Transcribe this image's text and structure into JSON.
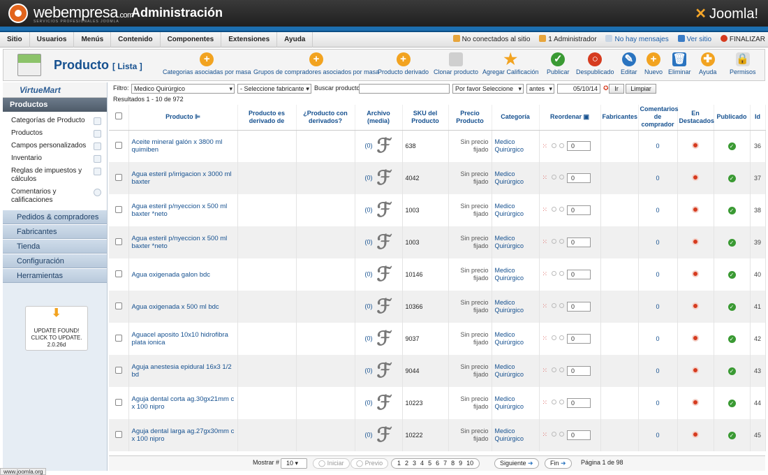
{
  "header": {
    "brand": "webempresa",
    "brand_suffix": ".com",
    "brand_sub": "SERVICIOS PROFESIONALES JOOMLA",
    "title": "Administración",
    "joomla_logo": "Joomla!"
  },
  "menu": [
    "Sitio",
    "Usuarios",
    "Menús",
    "Contenido",
    "Componentes",
    "Extensiones",
    "Ayuda"
  ],
  "status": {
    "visitors": "No conectados al sitio",
    "admins": "1 Administrador",
    "messages": "No hay mensajes",
    "view_site": "Ver sitio",
    "logout": "FINALIZAR"
  },
  "toolbar": {
    "page_title": "Producto",
    "page_sub": "[ Lista ]",
    "buttons": [
      {
        "label": "Categorias asociadas por masa",
        "icon": "plus-icon"
      },
      {
        "label": "Grupos de compradores asociados por masa",
        "icon": "plus-icon"
      },
      {
        "label": "Producto derivado",
        "icon": "plus-icon"
      },
      {
        "label": "Clonar producto",
        "icon": "clone-icon"
      },
      {
        "label": "Agregar Calificación",
        "icon": "star-icon"
      },
      {
        "label": "Publicar",
        "icon": "check-icon"
      },
      {
        "label": "Despublicado",
        "icon": "unpublish-icon"
      },
      {
        "label": "Editar",
        "icon": "edit-icon"
      },
      {
        "label": "Nuevo",
        "icon": "plus-icon"
      },
      {
        "label": "Eliminar",
        "icon": "trash-icon"
      },
      {
        "label": "Ayuda",
        "icon": "help-icon"
      },
      {
        "label": "Permisos",
        "icon": "lock-icon"
      }
    ]
  },
  "sidebar": {
    "logo": "VirtueMart",
    "section": "Productos",
    "items": [
      "Categorías de Producto",
      "Productos",
      "Campos personalizados",
      "Inventario",
      "Reglas de impuestos y cálculos",
      "Comentarios y calificaciones"
    ],
    "groups": [
      "Pedidos & compradores",
      "Fabricantes",
      "Tienda",
      "Configuración",
      "Herramientas"
    ],
    "update": {
      "line1": "UPDATE FOUND!",
      "line2": "CLICK TO UPDATE.",
      "line3": "2.0.26d"
    }
  },
  "filter": {
    "label": "Filtro:",
    "category": "Medico Quirúrgico",
    "manufacturer": "- Seleccione fabricante -",
    "search_label": "Buscar producto",
    "search_value": "",
    "date_select": "Por favor Seleccione",
    "when": "antes",
    "date": "05/10/14",
    "go": "Ir",
    "clear": "Limpiar"
  },
  "results": "Resultados 1 - 10 de 972",
  "columns": [
    "Producto",
    "Producto es derivado de",
    "¿Producto con derivados?",
    "Archivo (media)",
    "SKU del Producto",
    "Precio Producto",
    "Categoría",
    "Reordenar",
    "Fabricantes",
    "Comentarios de comprador",
    "En Destacados",
    "Publicado",
    "Id"
  ],
  "rows": [
    {
      "name": "Aceite mineral galón x 3800 ml quimiben",
      "media": "(0)",
      "sku": "638",
      "price": "Sin precio fijado",
      "category": "Medico Quirúrgico",
      "order": "0",
      "reviews": "0",
      "id": "36"
    },
    {
      "name": "Agua esteril p/irrigacion x 3000 ml baxter",
      "media": "(0)",
      "sku": "4042",
      "price": "Sin precio fijado",
      "category": "Medico Quirúrgico",
      "order": "0",
      "reviews": "0",
      "id": "37"
    },
    {
      "name": "Agua esteril p/nyeccion x 500 ml baxter *neto",
      "media": "(0)",
      "sku": "1003",
      "price": "Sin precio fijado",
      "category": "Medico Quirúrgico",
      "order": "0",
      "reviews": "0",
      "id": "38"
    },
    {
      "name": "Agua esteril p/nyeccion x 500 ml baxter *neto",
      "media": "(0)",
      "sku": "1003",
      "price": "Sin precio fijado",
      "category": "Medico Quirúrgico",
      "order": "0",
      "reviews": "0",
      "id": "39"
    },
    {
      "name": "Agua oxigenada galon bdc",
      "media": "(0)",
      "sku": "10146",
      "price": "Sin precio fijado",
      "category": "Medico Quirúrgico",
      "order": "0",
      "reviews": "0",
      "id": "40"
    },
    {
      "name": "Agua oxigenada x 500 ml bdc",
      "media": "(0)",
      "sku": "10366",
      "price": "Sin precio fijado",
      "category": "Medico Quirúrgico",
      "order": "0",
      "reviews": "0",
      "id": "41"
    },
    {
      "name": "Aguacel aposito 10x10 hidrofibra plata ionica",
      "media": "(0)",
      "sku": "9037",
      "price": "Sin precio fijado",
      "category": "Medico Quirúrgico",
      "order": "0",
      "reviews": "0",
      "id": "42"
    },
    {
      "name": "Aguja anestesia epidural 16x3 1/2 bd",
      "media": "(0)",
      "sku": "9044",
      "price": "Sin precio fijado",
      "category": "Medico Quirúrgico",
      "order": "0",
      "reviews": "0",
      "id": "43"
    },
    {
      "name": "Aguja dental corta ag.30gx21mm c x 100 nipro",
      "media": "(0)",
      "sku": "10223",
      "price": "Sin precio fijado",
      "category": "Medico Quirúrgico",
      "order": "0",
      "reviews": "0",
      "id": "44"
    },
    {
      "name": "Aguja dental larga ag.27gx30mm c x 100 nipro",
      "media": "(0)",
      "sku": "10222",
      "price": "Sin precio fijado",
      "category": "Medico Quirúrgico",
      "order": "0",
      "reviews": "0",
      "id": "45"
    }
  ],
  "pagination": {
    "show_label": "Mostrar #",
    "show_value": "10",
    "start": "Iniciar",
    "prev": "Previo",
    "pages": [
      "1",
      "2",
      "3",
      "4",
      "5",
      "6",
      "7",
      "8",
      "9",
      "10"
    ],
    "next": "Siguiente",
    "end": "Fin",
    "page_info": "Página 1 de 98"
  },
  "statusbar": "www.joomla.org"
}
